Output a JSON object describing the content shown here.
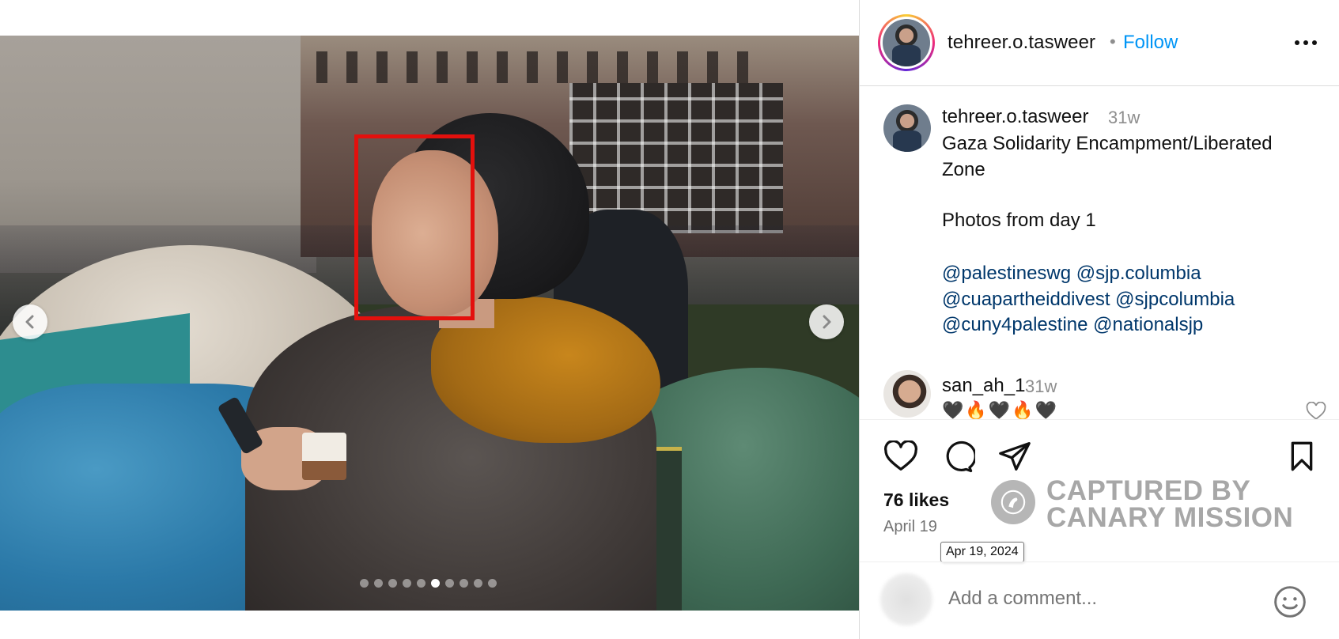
{
  "post": {
    "username": "tehreer.o.tasweer",
    "separator": "•",
    "follow_label": "Follow",
    "carousel": {
      "total_slides": 10,
      "active_index": 5
    }
  },
  "caption": {
    "username": "tehreer.o.tasweer",
    "time": "31w",
    "lines": [
      "Gaza Solidarity Encampment/Liberated Zone",
      "Photos from day 1"
    ],
    "mentions": [
      "@palestineswg",
      "@sjp.columbia",
      "@cuapartheiddivest",
      "@sjpcolumbia",
      "@cuny4palestine",
      "@nationalsjp"
    ]
  },
  "comment": {
    "username": "san_ah_1",
    "time": "31w",
    "text": "🖤🔥🖤🔥🖤"
  },
  "stats": {
    "likes": "76 likes",
    "date": "April 19",
    "date_tooltip": "Apr 19, 2024"
  },
  "watermark": {
    "line1": "CAPTURED BY",
    "line2": "CANARY MISSION"
  },
  "comment_box": {
    "placeholder": "Add a comment..."
  },
  "icons": {
    "more": "more-options-icon",
    "like": "heart-icon",
    "comment": "comment-bubble-icon",
    "share": "paper-plane-icon",
    "save": "bookmark-icon",
    "emoji": "smiley-icon",
    "prev": "chevron-left-icon",
    "next": "chevron-right-icon"
  },
  "colors": {
    "follow": "#0095f6",
    "mention": "#00376b",
    "highlight_box": "#e3100d",
    "secondary_text": "#8e8e8e"
  }
}
